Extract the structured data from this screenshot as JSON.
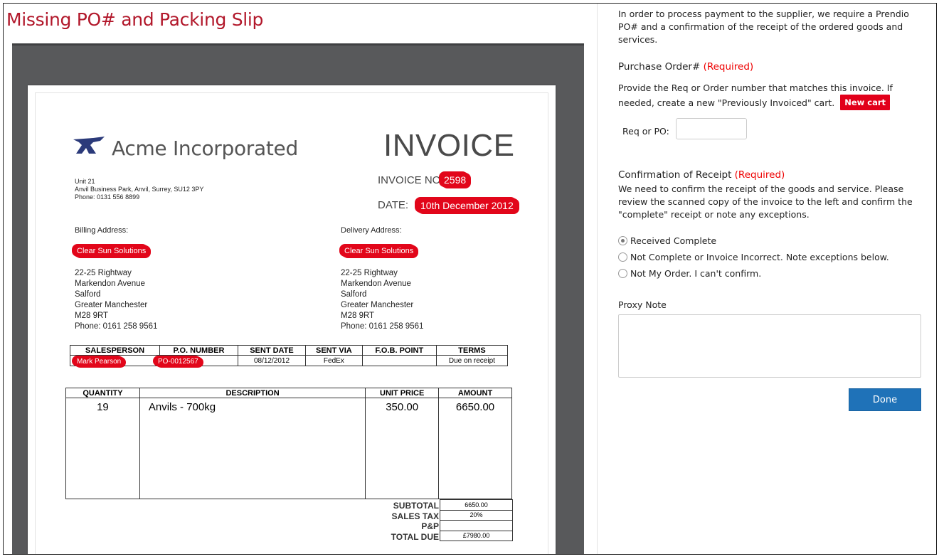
{
  "page": {
    "title": "Missing PO# and Packing Slip"
  },
  "invoice": {
    "company": "Acme Incorporated",
    "heading": "INVOICE",
    "company_address": [
      "Unit 21",
      "Anvil Business Park, Anvil, Surrey, SU12 3PY",
      "Phone: 0131 556 8899"
    ],
    "invoice_no_label": "INVOICE NO:",
    "invoice_no": "2598",
    "date_label": "DATE:",
    "date": "10th December 2012",
    "billing_label": "Billing Address:",
    "delivery_label": "Delivery Address:",
    "billing_name": "Clear Sun Solutions",
    "delivery_name": "Clear Sun Solutions",
    "billing_address": [
      "22-25 Rightway",
      "Markendon Avenue",
      "Salford",
      "Greater Manchester",
      "M28 9RT",
      "Phone: 0161 258 9561"
    ],
    "delivery_address": [
      "22-25 Rightway",
      "Markendon Avenue",
      "Salford",
      "Greater Manchester",
      "M28 9RT",
      "Phone: 0161 258 9561"
    ],
    "order_table": {
      "headers": [
        "SALESPERSON",
        "P.O. NUMBER",
        "SENT DATE",
        "SENT VIA",
        "F.O.B. POINT",
        "TERMS"
      ],
      "row": [
        "Mark Pearson",
        "PO-0012567",
        "08/12/2012",
        "FedEx",
        "",
        "Due on receipt"
      ]
    },
    "items_table": {
      "headers": [
        "QUANTITY",
        "DESCRIPTION",
        "UNIT PRICE",
        "AMOUNT"
      ],
      "row": [
        "19",
        "Anvils - 700kg",
        "350.00",
        "6650.00"
      ]
    },
    "totals": {
      "labels": [
        "SUBTOTAL",
        "SALES TAX",
        "P&P",
        "TOTAL DUE"
      ],
      "values": [
        "6650.00",
        "20%",
        "",
        "£7980.00"
      ]
    }
  },
  "form": {
    "intro": "In order to process payment to the supplier, we require a Prendio PO# and a confirmation of the receipt of the ordered goods and services.",
    "po_title": "Purchase Order#",
    "required": "(Required)",
    "po_desc": "Provide the Req or Order number that matches this invoice. If needed, create a new \"Previously Invoiced\" cart.",
    "new_cart": "New cart",
    "req_label": "Req or PO:",
    "req_value": "",
    "confirm_title": "Confirmation of Receipt",
    "confirm_desc": "We need to confirm the receipt of the goods and service. Please review the scanned copy of the invoice to the left and confirm the \"complete\" receipt or note any exceptions.",
    "options": [
      {
        "label": "Received Complete",
        "checked": true
      },
      {
        "label": "Not Complete or Invoice Incorrect. Note exceptions below.",
        "checked": false
      },
      {
        "label": "Not My Order. I can't confirm.",
        "checked": false
      }
    ],
    "proxy_label": "Proxy Note",
    "proxy_value": "",
    "done": "Done"
  }
}
